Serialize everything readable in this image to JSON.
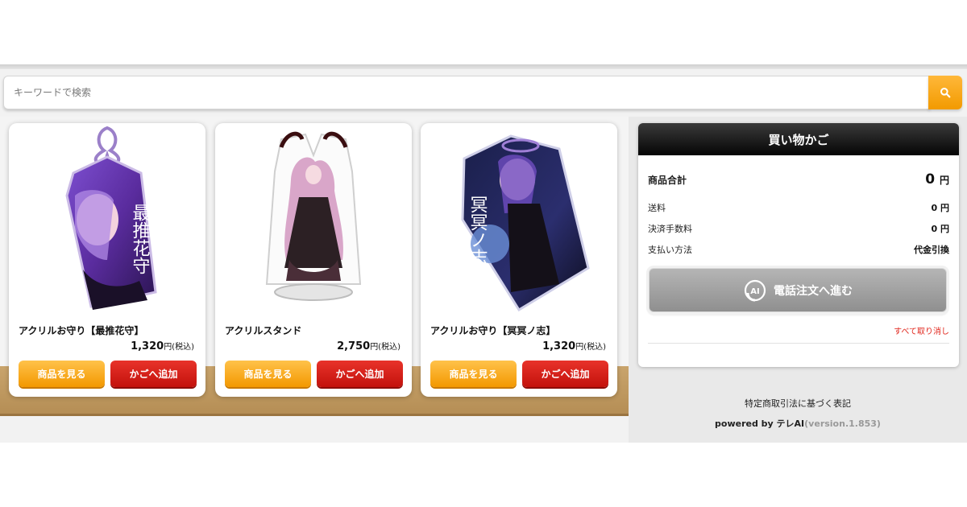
{
  "search": {
    "placeholder": "キーワードで検索",
    "icon": "search-icon"
  },
  "products": [
    {
      "name": "アクリルお守り【最推花守】",
      "price": "1,320",
      "tax_note": "円(税込)",
      "view_label": "商品を見る",
      "cart_label": "かごへ追加",
      "image_text": "最推花守"
    },
    {
      "name": "アクリルスタンド",
      "price": "2,750",
      "tax_note": "円(税込)",
      "view_label": "商品を見る",
      "cart_label": "かごへ追加"
    },
    {
      "name": "アクリルお守り【冥冥ノ志】",
      "price": "1,320",
      "tax_note": "円(税込)",
      "view_label": "商品を見る",
      "cart_label": "かごへ追加",
      "image_text": "冥冥ノ志"
    }
  ],
  "cart": {
    "title": "買い物かご",
    "subtotal_label": "商品合計",
    "subtotal_value": "0",
    "subtotal_unit": "円",
    "shipping_label": "送料",
    "shipping_value": "0 円",
    "fee_label": "決済手数料",
    "fee_value": "0 円",
    "payment_label": "支払い方法",
    "payment_value": "代金引換",
    "phone_button_label": "電話注文へ進む",
    "phone_icon_text": "AI",
    "clear_label": "すべて取り消し"
  },
  "footer": {
    "legal_label": "特定商取引法に基づく表記",
    "powered_by": "powered by テレAI",
    "version": "(version.1.853)"
  },
  "colors": {
    "orange": "#f39800",
    "red": "#d0201a",
    "purple": "#6b3aa8",
    "header_black": "#111111"
  }
}
